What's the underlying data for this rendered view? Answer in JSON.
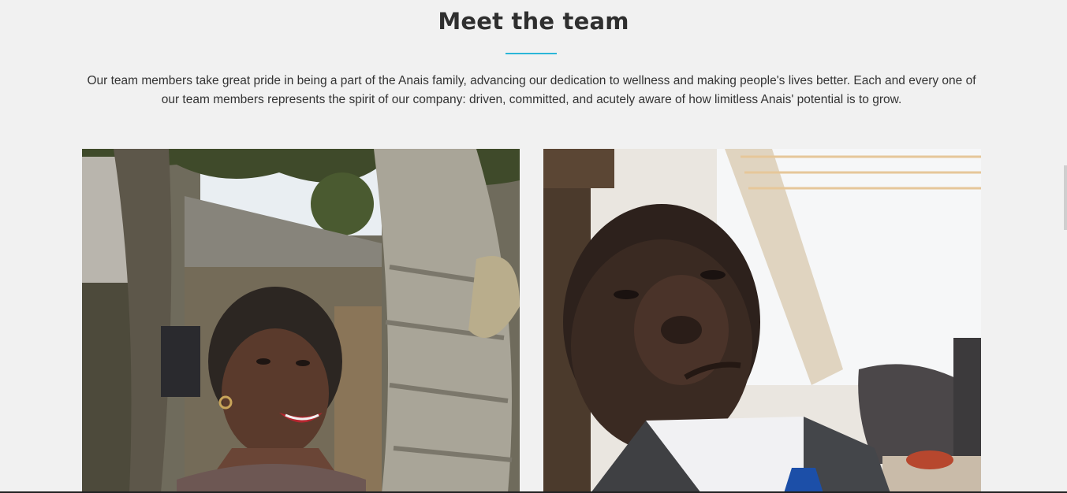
{
  "section": {
    "title": "Meet the team",
    "description": "Our team members take great pride in being a part of the Anais family, advancing our dedication to wellness and making people's lives better. Each and every one of our team members represents the spirit of our company: driven, committed, and acutely aware of how limitless Anais' potential is to grow."
  },
  "team_photos": [
    {
      "subject": "woman-smiling-outdoors"
    },
    {
      "subject": "man-in-suit-office"
    }
  ],
  "colors": {
    "accent": "#2bb6d8",
    "background": "#f1f1f1",
    "heading": "#2f2f2f",
    "body_text": "#333333"
  }
}
